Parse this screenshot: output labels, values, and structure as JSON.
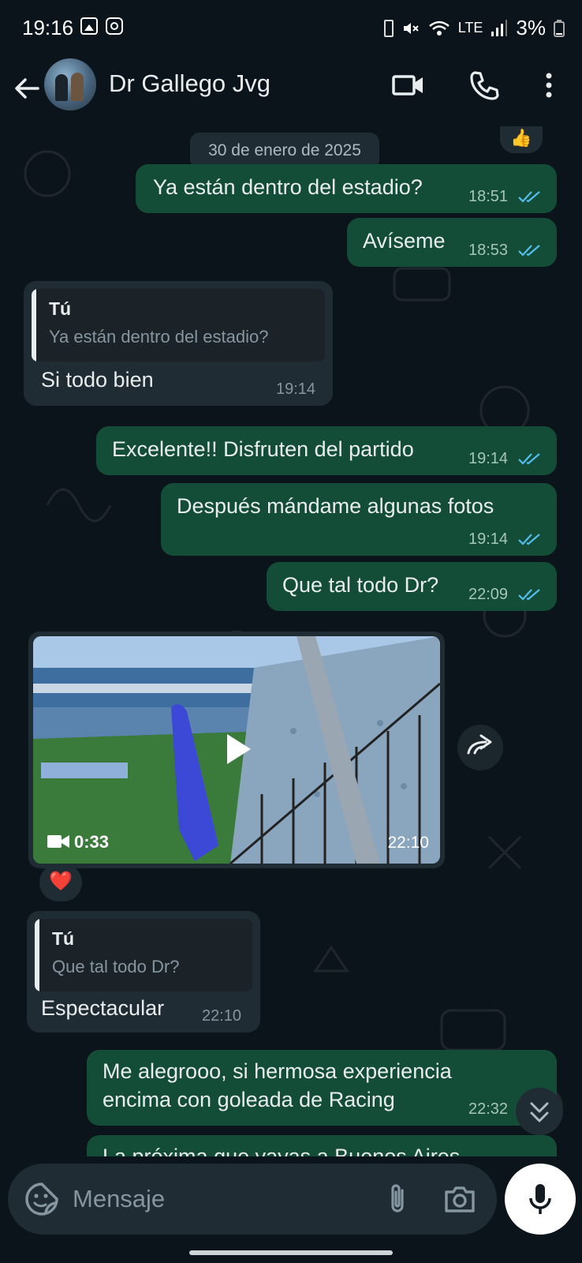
{
  "status_bar": {
    "time": "19:16",
    "network": "LTE",
    "battery": "3%"
  },
  "header": {
    "contact_name": "Dr Gallego Jvg"
  },
  "chat": {
    "date_separator": "30 de enero de 2025",
    "reaction_thumb": "👍",
    "messages": [
      {
        "text": "Ya están dentro del estadio?",
        "time": "18:51"
      },
      {
        "text": "Avíseme",
        "time": "18:53"
      },
      {
        "quote_author": "Tú",
        "quote_text": "Ya están dentro del estadio?",
        "text": "Si todo bien",
        "time": "19:14"
      },
      {
        "text": "Excelente!! Disfruten del partido",
        "time": "19:14"
      },
      {
        "text": "Después mándame algunas fotos",
        "time": "19:14"
      },
      {
        "text": "Que tal todo Dr?",
        "time": "22:09"
      },
      {
        "video_duration": "0:33",
        "time": "22:10",
        "reaction": "❤️"
      },
      {
        "quote_author": "Tú",
        "quote_text": "Que tal todo Dr?",
        "text": "Espectacular",
        "time": "22:10"
      },
      {
        "text_line1": "Me alegrooo, si hermosa experiencia",
        "text_line2": "encima con goleada de Racing",
        "time": "22:32"
      },
      {
        "text": "La próxima que vayas a Buenos Aires"
      }
    ]
  },
  "input": {
    "placeholder": "Mensaje"
  },
  "colors": {
    "outgoing_bubble": "#144d37",
    "incoming_bubble": "#202c33",
    "read_ticks": "#53bdeb",
    "background": "#0b141a"
  }
}
